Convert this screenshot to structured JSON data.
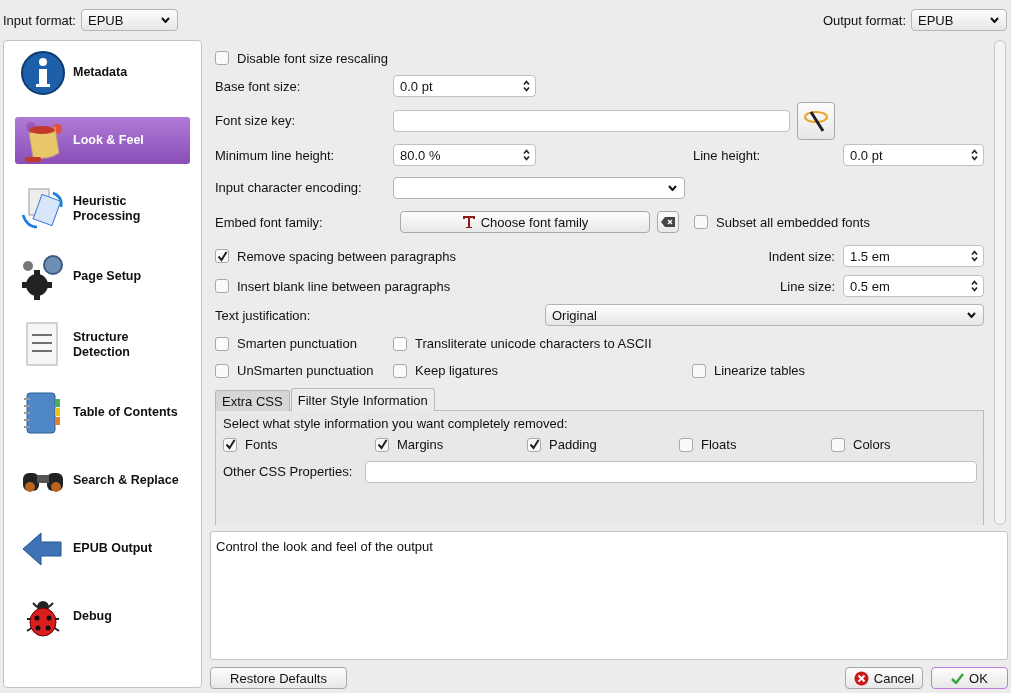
{
  "input_format": {
    "label": "Input format:",
    "value": "EPUB"
  },
  "output_format": {
    "label": "Output format:",
    "value": "EPUB"
  },
  "sidebar": {
    "items": [
      {
        "label": "Metadata",
        "kind": "info",
        "selected": false
      },
      {
        "label": "Look & Feel",
        "kind": "paint",
        "selected": true
      },
      {
        "label": "Heuristic Processing",
        "kind": "pages",
        "selected": false
      },
      {
        "label": "Page Setup",
        "kind": "gears",
        "selected": false
      },
      {
        "label": "Structure Detection",
        "kind": "document",
        "selected": false
      },
      {
        "label": "Table of Contents",
        "kind": "book",
        "selected": false
      },
      {
        "label": "Search & Replace",
        "kind": "binoculars",
        "selected": false
      },
      {
        "label": "EPUB Output",
        "kind": "arrow",
        "selected": false
      },
      {
        "label": "Debug",
        "kind": "ladybug",
        "selected": false
      }
    ]
  },
  "options": {
    "disable_rescaling": {
      "label": "Disable font size rescaling",
      "checked": false
    },
    "base_font_size": {
      "label": "Base font size:",
      "value": "0.0 pt"
    },
    "font_size_key": {
      "label": "Font size key:"
    },
    "minimum_line_height": {
      "label": "Minimum line height:",
      "value": "80.0 %"
    },
    "line_height": {
      "label": "Line height:",
      "value": "0.0 pt"
    },
    "input_encoding": {
      "label": "Input character encoding:"
    },
    "embed_font_family": {
      "label": "Embed font family:",
      "button": "Choose font family"
    },
    "subset_fonts": {
      "label": "Subset all embedded fonts",
      "checked": false
    },
    "remove_spacing": {
      "label": "Remove spacing between paragraphs",
      "checked": true
    },
    "indent_size": {
      "label": "Indent size:",
      "value": "1.5 em"
    },
    "insert_blank_line": {
      "label": "Insert blank line between paragraphs",
      "checked": false
    },
    "line_size": {
      "label": "Line size:",
      "value": "0.5 em"
    },
    "text_justification": {
      "label": "Text justification:",
      "value": "Original"
    },
    "smarten": {
      "label": "Smarten punctuation",
      "checked": false
    },
    "transliterate": {
      "label": "Transliterate unicode characters to ASCII",
      "checked": false
    },
    "unsmarten": {
      "label": "UnSmarten punctuation",
      "checked": false
    },
    "keep_ligatures": {
      "label": "Keep ligatures",
      "checked": false
    },
    "linearize_tables": {
      "label": "Linearize tables",
      "checked": false
    }
  },
  "tabs": [
    {
      "label": "Extra CSS",
      "selected": false
    },
    {
      "label": "Filter Style Information",
      "selected": true
    }
  ],
  "filter": {
    "prompt": "Select what style information you want completely removed:",
    "checkboxes": [
      {
        "label": "Fonts",
        "checked": true
      },
      {
        "label": "Margins",
        "checked": true
      },
      {
        "label": "Padding",
        "checked": true
      },
      {
        "label": "Floats",
        "checked": false
      },
      {
        "label": "Colors",
        "checked": false
      }
    ],
    "other_css": {
      "label": "Other CSS Properties:"
    }
  },
  "description": "Control the look and feel of the output",
  "buttons": {
    "restore": "Restore Defaults",
    "cancel": "Cancel",
    "ok": "OK"
  }
}
